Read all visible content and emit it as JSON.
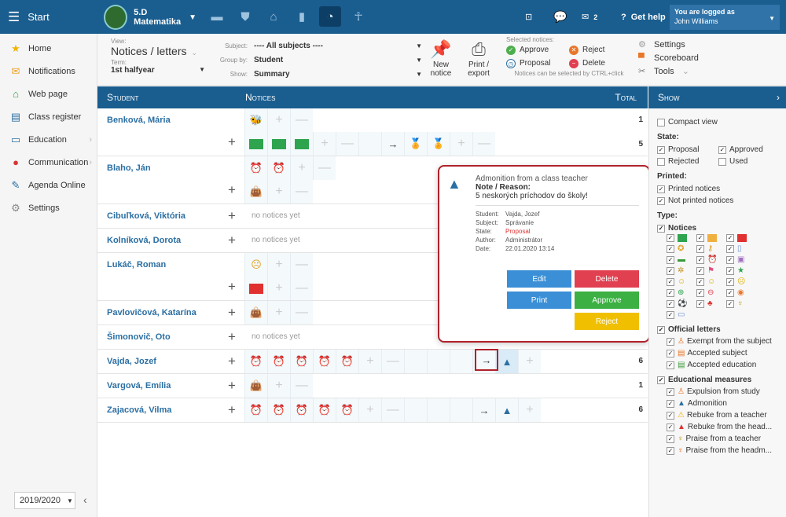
{
  "topbar": {
    "start_label": "Start",
    "class_code": "5.D",
    "class_subject": "Matematika",
    "messages_count": "2",
    "help_label": "Get help",
    "logged_as": "You are logged as",
    "user_name": "John Williams"
  },
  "sidebar": {
    "items": [
      {
        "label": "Home",
        "icon": "star-icon"
      },
      {
        "label": "Notifications",
        "icon": "envelope-icon"
      },
      {
        "label": "Web page",
        "icon": "house-icon"
      },
      {
        "label": "Class register",
        "icon": "book-icon"
      },
      {
        "label": "Education",
        "icon": "education-icon"
      },
      {
        "label": "Communication",
        "icon": "chat-icon"
      },
      {
        "label": "Agenda Online",
        "icon": "pen-icon"
      },
      {
        "label": "Settings",
        "icon": "gear-icon"
      }
    ],
    "year": "2019/2020"
  },
  "toolbar": {
    "view_label": "View:",
    "view_value": "Notices / letters",
    "term_label": "Term:",
    "term_value": "1st halfyear",
    "subject_label": "Subject:",
    "subject_value": "---- All subjects ----",
    "groupby_label": "Group by:",
    "groupby_value": "Student",
    "show_label": "Show:",
    "show_value": "Summary",
    "new_notice": "New notice",
    "print_export": "Print / export",
    "selected_notices": "Selected notices:",
    "approve": "Approve",
    "reject": "Reject",
    "proposal": "Proposal",
    "delete": "Delete",
    "ctrl_hint": "Notices can be selected by CTRL+click",
    "settings": "Settings",
    "scoreboard": "Scoreboard",
    "tools": "Tools"
  },
  "grid": {
    "col_student": "Student",
    "col_notices": "Notices",
    "col_total": "Total",
    "no_notices": "no notices yet",
    "students": [
      {
        "name": "Benková, Mária",
        "totals": [
          "1",
          "5"
        ]
      },
      {
        "name": "Blaho, Ján",
        "totals": []
      },
      {
        "name": "Cibuľková, Viktória",
        "totals": []
      },
      {
        "name": "Kolníková, Dorota",
        "totals": []
      },
      {
        "name": "Lukáč, Roman",
        "totals": []
      },
      {
        "name": "Pavlovičová, Katarína",
        "totals": []
      },
      {
        "name": "Šimonovič, Oto",
        "totals": []
      },
      {
        "name": "Vajda, Jozef",
        "totals": [
          "6"
        ]
      },
      {
        "name": "Vargová, Emília",
        "totals": [
          "1"
        ]
      },
      {
        "name": "Zajacová, Vilma",
        "totals": [
          "6"
        ]
      }
    ]
  },
  "popup": {
    "title": "Admonition from a class teacher",
    "note_label": "Note / Reason:",
    "reason": "5 neskorých príchodov do školy!",
    "student_k": "Student:",
    "student_v": "Vajda, Jozef",
    "subject_k": "Subject:",
    "subject_v": "Správanie",
    "state_k": "State:",
    "state_v": "Proposal",
    "author_k": "Author:",
    "author_v": "Administrátor",
    "date_k": "Date:",
    "date_v": "22.01.2020 13:14",
    "edit": "Edit",
    "delete": "Delete",
    "print": "Print",
    "approve": "Approve",
    "reject": "Reject"
  },
  "panel": {
    "title": "Show",
    "compact": "Compact view",
    "state": "State:",
    "proposal": "Proposal",
    "approved": "Approved",
    "rejected": "Rejected",
    "used": "Used",
    "printed": "Printed:",
    "printed_notices": "Printed notices",
    "not_printed": "Not printed notices",
    "type": "Type:",
    "notices": "Notices",
    "official_letters": "Official letters",
    "exempt": "Exempt from the subject",
    "accepted_subject": "Accepted subject",
    "accepted_education": "Accepted education",
    "educational_measures": "Educational measures",
    "expulsion": "Expulsion from study",
    "admonition": "Admonition",
    "rebuke_teacher": "Rebuke from a teacher",
    "rebuke_head": "Rebuke from the head...",
    "praise_teacher": "Praise from a teacher",
    "praise_head": "Praise from the headm..."
  }
}
